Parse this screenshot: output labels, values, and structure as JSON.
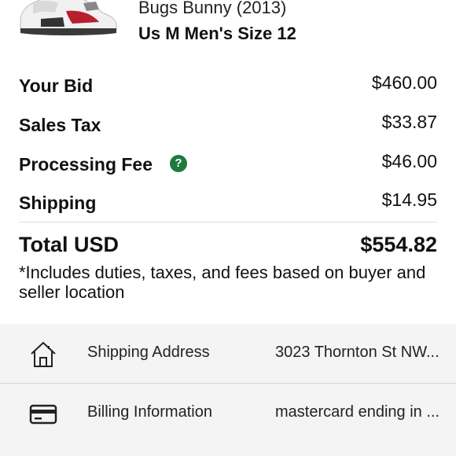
{
  "product": {
    "name": "Bugs Bunny (2013)",
    "size": "Us M Men's Size 12",
    "image_icon": "sneaker-thumbnail"
  },
  "summary": {
    "items": [
      {
        "label": "Your Bid",
        "amount": "$460.00"
      },
      {
        "label": "Sales Tax",
        "amount": "$33.87"
      },
      {
        "label": "Processing Fee",
        "amount": "$46.00",
        "help_icon": "question-circle-icon",
        "help_glyph": "?"
      },
      {
        "label": "Shipping",
        "amount": "$14.95"
      }
    ],
    "total_label": "Total USD",
    "total_amount": "$554.82",
    "note": "*Includes duties, taxes, and fees based on buyer and seller location"
  },
  "details": [
    {
      "icon": "home-icon",
      "title": "Shipping Address",
      "value": "3023 Thornton St NW..."
    },
    {
      "icon": "credit-card-icon",
      "title": "Billing Information",
      "value": "mastercard ending in ..."
    }
  ],
  "colors": {
    "help_icon_green": "#1f7a3e",
    "details_background": "#f4f4f4"
  }
}
